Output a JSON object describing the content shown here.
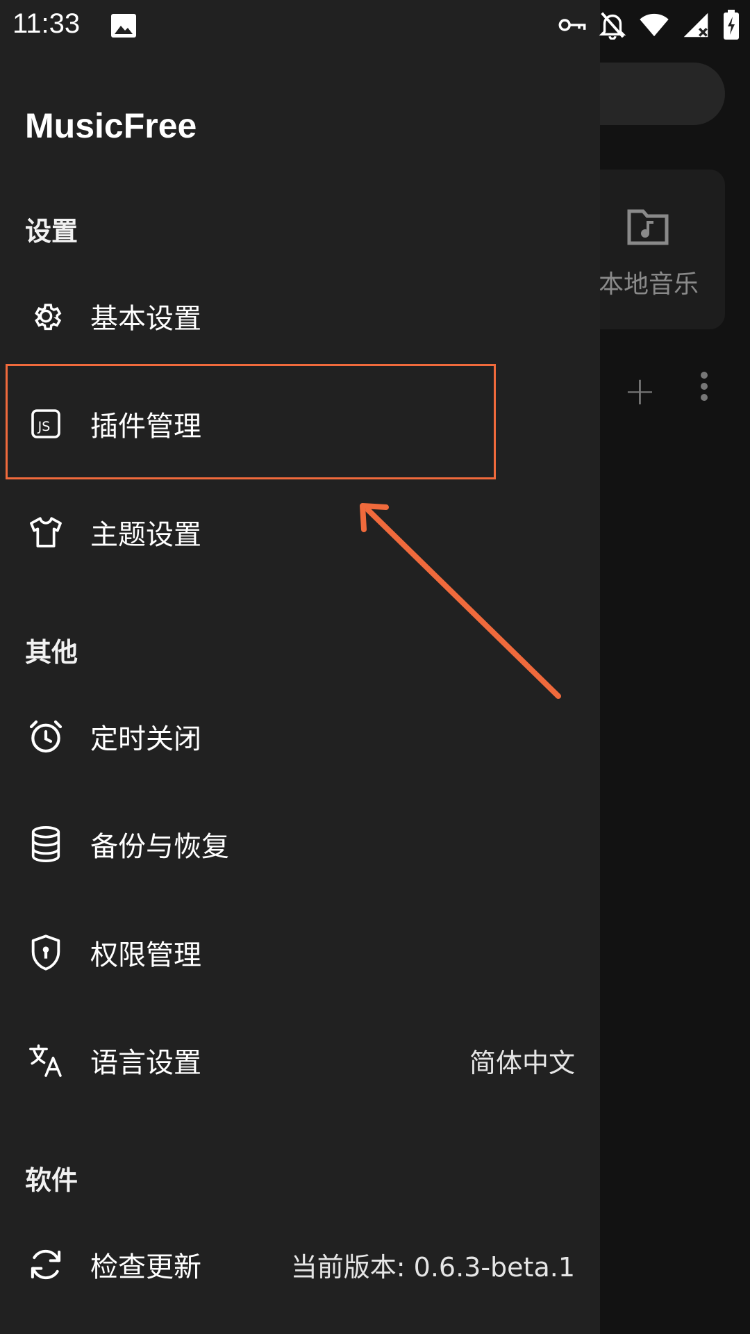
{
  "status_bar": {
    "time": "11:33"
  },
  "background": {
    "local_music_label": "本地音乐"
  },
  "drawer": {
    "app_title": "MusicFree",
    "sections": {
      "settings": "设置",
      "other": "其他",
      "software": "软件"
    },
    "items": {
      "basic_settings": "基本设置",
      "plugin_management": "插件管理",
      "theme_settings": "主题设置",
      "timer_close": "定时关闭",
      "backup_restore": "备份与恢复",
      "permission_management": "权限管理",
      "language_settings": "语言设置",
      "language_value": "简体中文",
      "check_update": "检查更新",
      "current_version": "当前版本: 0.6.3-beta.1"
    }
  },
  "colors": {
    "drawer_bg": "#212121",
    "highlight": "#f06a3c",
    "background": "#121212"
  }
}
